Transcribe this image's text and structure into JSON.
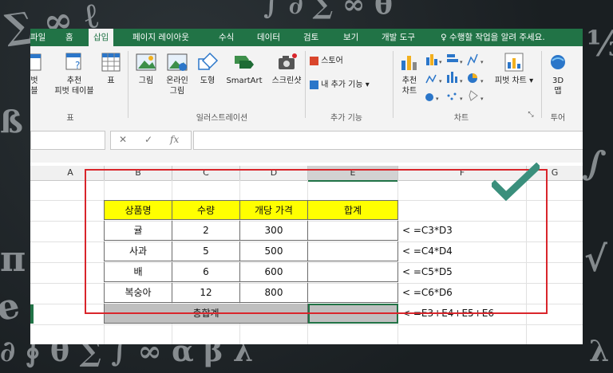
{
  "tabs": [
    "파일",
    "홈",
    "삽입",
    "페이지 레이아웃",
    "수식",
    "데이터",
    "검토",
    "보기",
    "개발 도구"
  ],
  "active_tab": "삽입",
  "tell_me": "수행할 작업을 알려 주세요.",
  "ribbon": {
    "tables_group": {
      "pivot_label_line1": "벗",
      "pivot_label_line2": "블",
      "recommended_line1": "추천",
      "recommended_line2": "피벗 테이블",
      "table_label": "표",
      "group_label": "표"
    },
    "illustrations_group": {
      "picture": "그림",
      "online_line1": "온라인",
      "online_line2": "그림",
      "shapes": "도형",
      "smartart": "SmartArt",
      "screenshot": "스크린샷",
      "group_label": "일러스트레이션"
    },
    "addins_group": {
      "store": "스토어",
      "my_addins": "내 추가 기능",
      "group_label": "추가 기능"
    },
    "charts_group": {
      "recommended_line1": "추천",
      "recommended_line2": "차트",
      "pivot_chart": "피벗 차트",
      "group_label": "차트"
    },
    "tours_group": {
      "map_line1": "3D",
      "map_line2": "맵",
      "group_label": "투어"
    }
  },
  "formula_bar": {
    "cancel": "✕",
    "enter": "✓",
    "fx": "fx",
    "value": ""
  },
  "columns": [
    "A",
    "B",
    "C",
    "D",
    "E",
    "F",
    "G"
  ],
  "selected_column": "E",
  "table": {
    "headers": [
      "상품명",
      "수량",
      "개당 가격",
      "합계"
    ],
    "rows": [
      {
        "name": "귤",
        "qty": "2",
        "price": "300",
        "total": ""
      },
      {
        "name": "사과",
        "qty": "5",
        "price": "500",
        "total": ""
      },
      {
        "name": "배",
        "qty": "6",
        "price": "600",
        "total": ""
      },
      {
        "name": "복숭아",
        "qty": "12",
        "price": "800",
        "total": ""
      }
    ],
    "grand_total_label": "총합계",
    "grand_total_value": ""
  },
  "formulas": [
    "<  =C3*D3",
    "<  =C4*D4",
    "<  =C5*D5",
    "<  =C6*D6",
    "<  =E3+E4+E5+E6"
  ],
  "colors": {
    "excel_green": "#217346",
    "header_yellow": "#ffff00",
    "total_gray": "#bfbfbf",
    "highlight_red": "#d9252b",
    "check_teal": "#3a8f7c"
  },
  "icons": [
    "chalkboard-background",
    "pivot-table-icon",
    "recommended-pivot-icon",
    "table-icon",
    "picture-icon",
    "online-picture-icon",
    "shapes-icon",
    "smartart-icon",
    "screenshot-icon",
    "store-icon",
    "my-addins-icon",
    "recommended-charts-icon",
    "column-chart-icon",
    "line-chart-icon",
    "pie-chart-icon",
    "pivot-chart-icon",
    "3d-map-icon",
    "lightbulb-icon",
    "check-mark-icon"
  ]
}
